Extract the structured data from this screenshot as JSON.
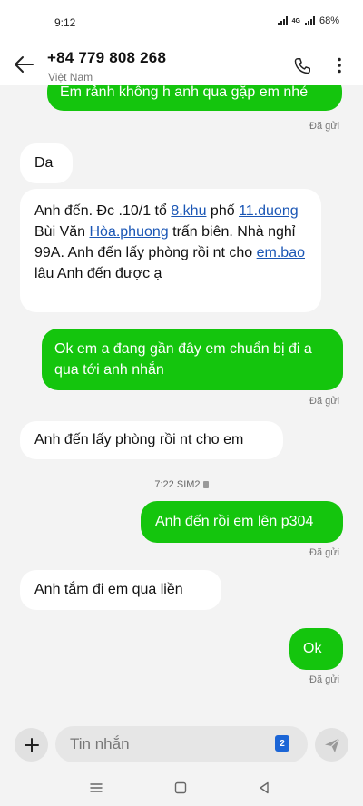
{
  "status": {
    "time": "9:12",
    "sim_label": "4G",
    "battery": "68%"
  },
  "header": {
    "phone_number": "+84 779 808 268",
    "country": "Việt Nam"
  },
  "messages": {
    "m1": {
      "text": "Em rảnh không h anh qua gặp em nhé",
      "status": "Đã gửi"
    },
    "m2": {
      "text": "Da"
    },
    "m3": {
      "p1": "Anh đến. Đc .10/1 tổ ",
      "link1": "8.khu",
      "p2": " phố ",
      "link2": "11.duong",
      "p3": " Bùi Văn ",
      "link3": "Hòa.phuong",
      "p4": " trấn biên. Nhà nghỉ 99A. Anh đến lấy phòng rồi nt cho ",
      "link4": "em.bao",
      "p5": " lâu Anh đến được ạ"
    },
    "m4": {
      "text": "Ok em a đang gần đây em chuẩn bị đi a qua tới anh nhắn",
      "status": "Đã gửi"
    },
    "m5": {
      "text": "Anh đến lấy phòng rồi nt cho em"
    },
    "separator": {
      "time": "7:22",
      "sim": "SIM2"
    },
    "m6": {
      "text": "Anh đến rồi em lên p304",
      "status": "Đã gửi"
    },
    "m7": {
      "text": "Anh tắm đi em qua liền"
    },
    "m8": {
      "text": "Ok",
      "status": "Đã gửi"
    }
  },
  "composer": {
    "placeholder": "Tin nhắn",
    "sim_badge": "2"
  },
  "icons": {
    "back": "arrow-left-icon",
    "call": "phone-icon",
    "menu": "more-vertical-icon",
    "add": "plus-icon",
    "send": "send-icon",
    "nav_recent": "menu-lines-icon",
    "nav_home": "square-icon",
    "nav_back": "triangle-back-icon"
  },
  "colors": {
    "outgoing_bubble": "#14c50d",
    "incoming_bubble": "#ffffff",
    "link": "#1a56b5",
    "sim_badge": "#1b65d6"
  }
}
